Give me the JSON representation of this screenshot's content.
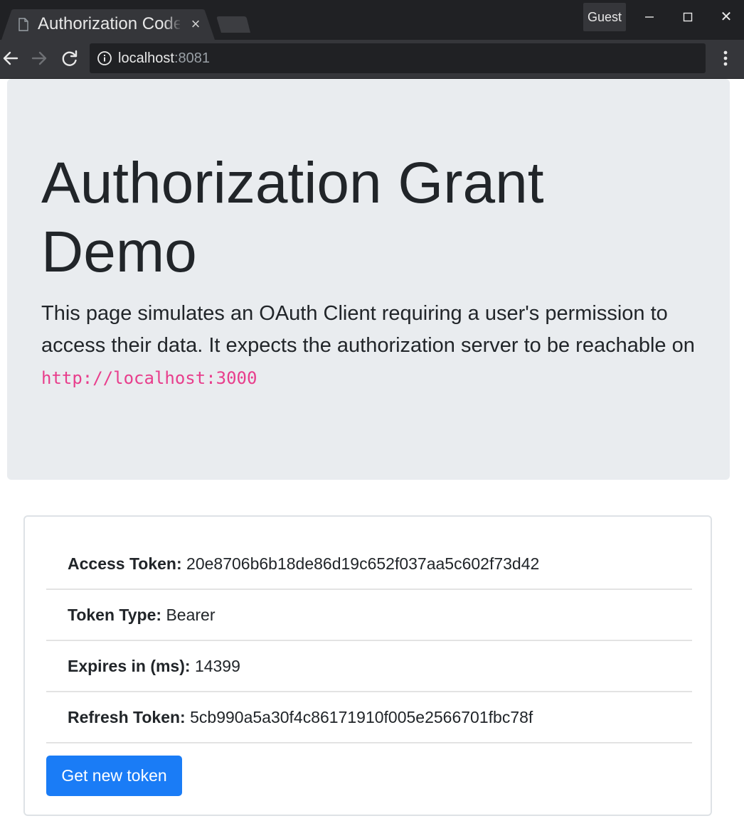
{
  "browser": {
    "tab_title": "Authorization Code Grant Demo",
    "tab_close_glyph": "×",
    "profile_label": "Guest",
    "window_controls": {
      "close_glyph": "✕"
    },
    "url_host": "localhost",
    "url_port": ":8081",
    "icons": {
      "tab": "document-icon",
      "back": "back-arrow-icon",
      "forward": "forward-arrow-icon",
      "reload": "reload-icon",
      "site_info": "info-icon",
      "menu": "kebab-menu-icon"
    },
    "colors": {
      "frame": "#202124",
      "toolbar": "#35363a"
    }
  },
  "jumbotron": {
    "title": "Authorization Grant Demo",
    "lead_text": "This page simulates an OAuth Client requiring a user's permission to access their data. It expects the authorization server to be reachable on ",
    "server_url": "http://localhost:3000",
    "colors": {
      "background": "#e9ecef",
      "code": "#e83e8c"
    }
  },
  "token_card": {
    "items": [
      {
        "label": "Access Token:",
        "value": "20e8706b6b18de86d19c652f037aa5c602f73d42"
      },
      {
        "label": "Token Type:",
        "value": "Bearer"
      },
      {
        "label": "Expires in (ms):",
        "value": "14399"
      },
      {
        "label": "Refresh Token:",
        "value": "5cb990a5a30f4c86171910f005e2566701fbc78f"
      }
    ],
    "button_label": "Get new token",
    "colors": {
      "button": "#1a7cf6"
    }
  }
}
